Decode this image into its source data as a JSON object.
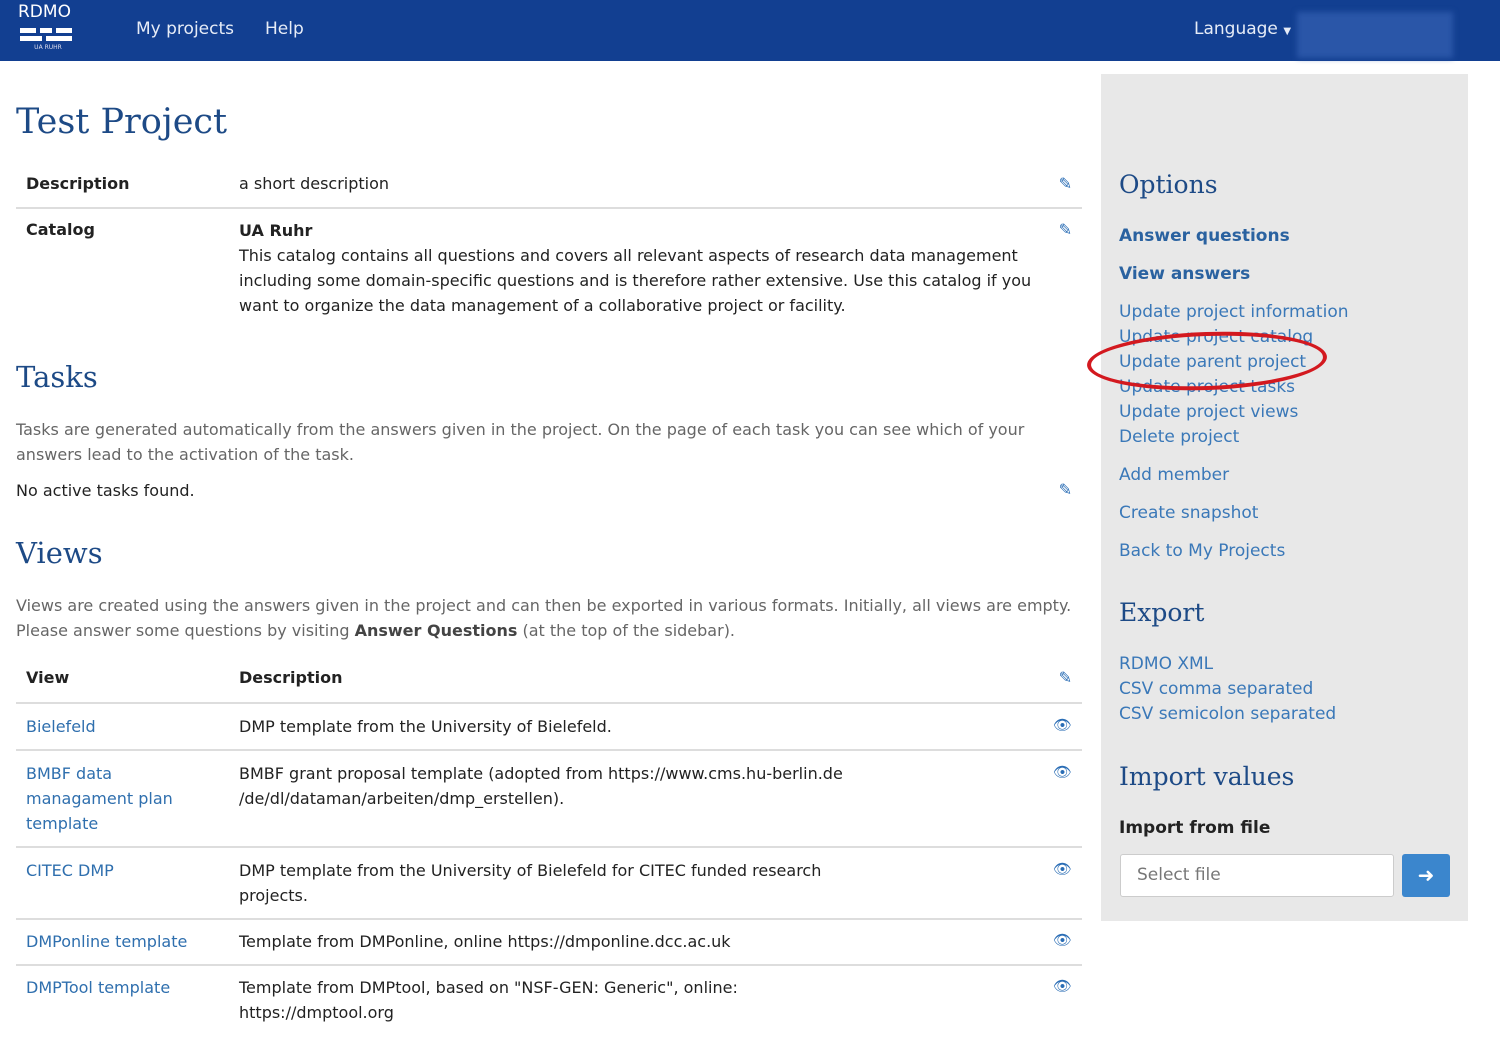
{
  "navbar": {
    "brand": "RDMO",
    "brand_sub": "UA RUHR",
    "links": [
      "My projects",
      "Help"
    ],
    "language": "Language"
  },
  "project": {
    "title": "Test Project",
    "description_label": "Description",
    "description": "a short description",
    "catalog_label": "Catalog",
    "catalog_name": "UA Ruhr",
    "catalog_text": "This catalog contains all questions and covers all relevant aspects of research data management including some domain-specific questions and is therefore rather extensive. Use this catalog if you want to organize the data management of a collaborative project or facility."
  },
  "tasks": {
    "title": "Tasks",
    "intro": "Tasks are generated automatically from the answers given in the project. On the page of each task you can see which of your answers lead to the activation of the task.",
    "empty": "No active tasks found."
  },
  "views": {
    "title": "Views",
    "intro_1": "Views are created using the answers given in the project and can then be exported in various formats. Initially, all views are empty. Please answer some questions by visiting ",
    "intro_bold": "Answer Questions",
    "intro_2": " (at the top of the sidebar).",
    "col_view": "View",
    "col_description": "Description",
    "rows": [
      {
        "name": "Bielefeld",
        "description": "DMP template from the University of Bielefeld."
      },
      {
        "name": "BMBF data managament plan template",
        "description": "BMBF grant proposal template (adopted from https://www.cms.hu-berlin.de /de/dl/dataman/arbeiten/dmp_erstellen)."
      },
      {
        "name": "CITEC DMP",
        "description": "DMP template from the University of Bielefeld for CITEC funded research projects."
      },
      {
        "name": "DMPonline template",
        "description": "Template from DMPonline, online https://dmponline.dcc.ac.uk"
      },
      {
        "name": "DMPTool template",
        "description": "Template from DMPtool, based on \"NSF-GEN: Generic\", online: https://dmptool.org"
      }
    ]
  },
  "sidebar": {
    "options_title": "Options",
    "options": [
      "Answer questions",
      "View answers",
      "Update project information",
      "Update project catalog",
      "Update parent project",
      "Update project tasks",
      "Update project views",
      "Delete project",
      "Add member",
      "Create snapshot",
      "Back to My Projects"
    ],
    "export_title": "Export",
    "export": [
      "RDMO XML",
      "CSV comma separated",
      "CSV semicolon separated"
    ],
    "import_title": "Import values",
    "import_label": "Import from file",
    "file_placeholder": "Select file"
  },
  "colors": {
    "navbar": "#123f91",
    "link": "#3a78b8",
    "highlight": "#d3191f"
  }
}
